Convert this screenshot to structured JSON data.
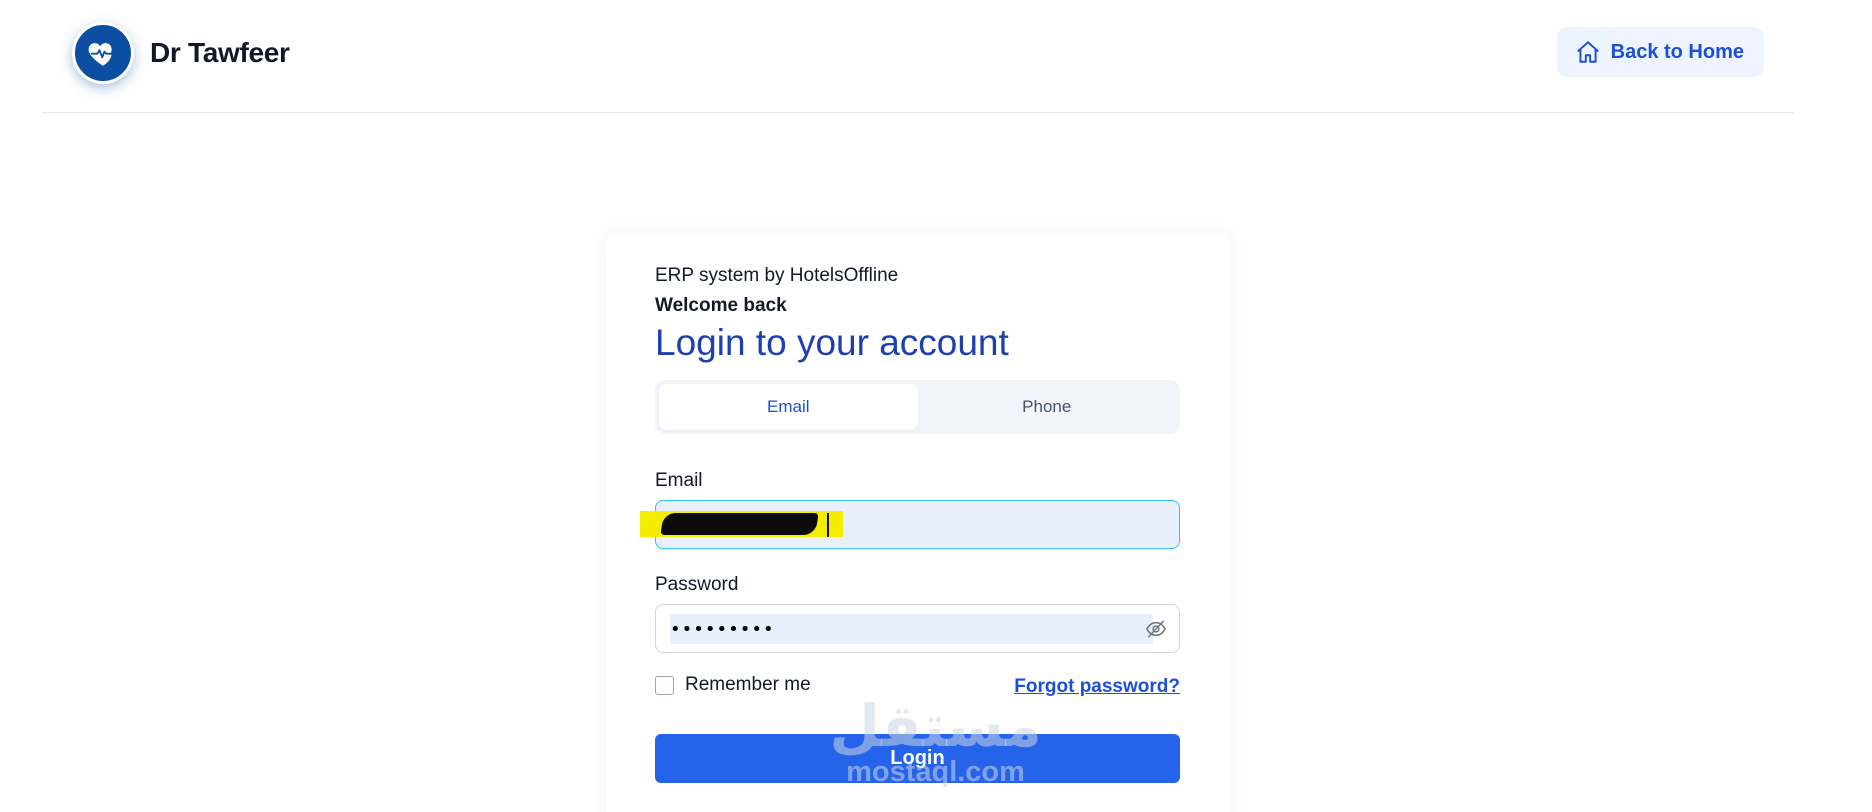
{
  "header": {
    "brand_name": "Dr Tawfeer",
    "logo_icon": "heart-pulse-icon",
    "back_home_label": "Back to Home",
    "back_home_icon": "home-icon"
  },
  "login": {
    "subtitle": "ERP system by HotelsOffline",
    "welcome": "Welcome back",
    "heading": "Login to your account",
    "tabs": [
      {
        "label": "Email",
        "active": true
      },
      {
        "label": "Phone",
        "active": false
      }
    ],
    "email_label": "Email",
    "password_label": "Password",
    "password_value": "•••••••••",
    "remember_label": "Remember me",
    "forgot_label": "Forgot password?",
    "login_label": "Login"
  },
  "watermark": {
    "arabic": "مستقل",
    "latin": "mostaql.com"
  },
  "colors": {
    "brand_blue": "#0b4ea2",
    "primary": "#2563eb",
    "heading": "#1e40af",
    "link": "#1d4ed8"
  }
}
